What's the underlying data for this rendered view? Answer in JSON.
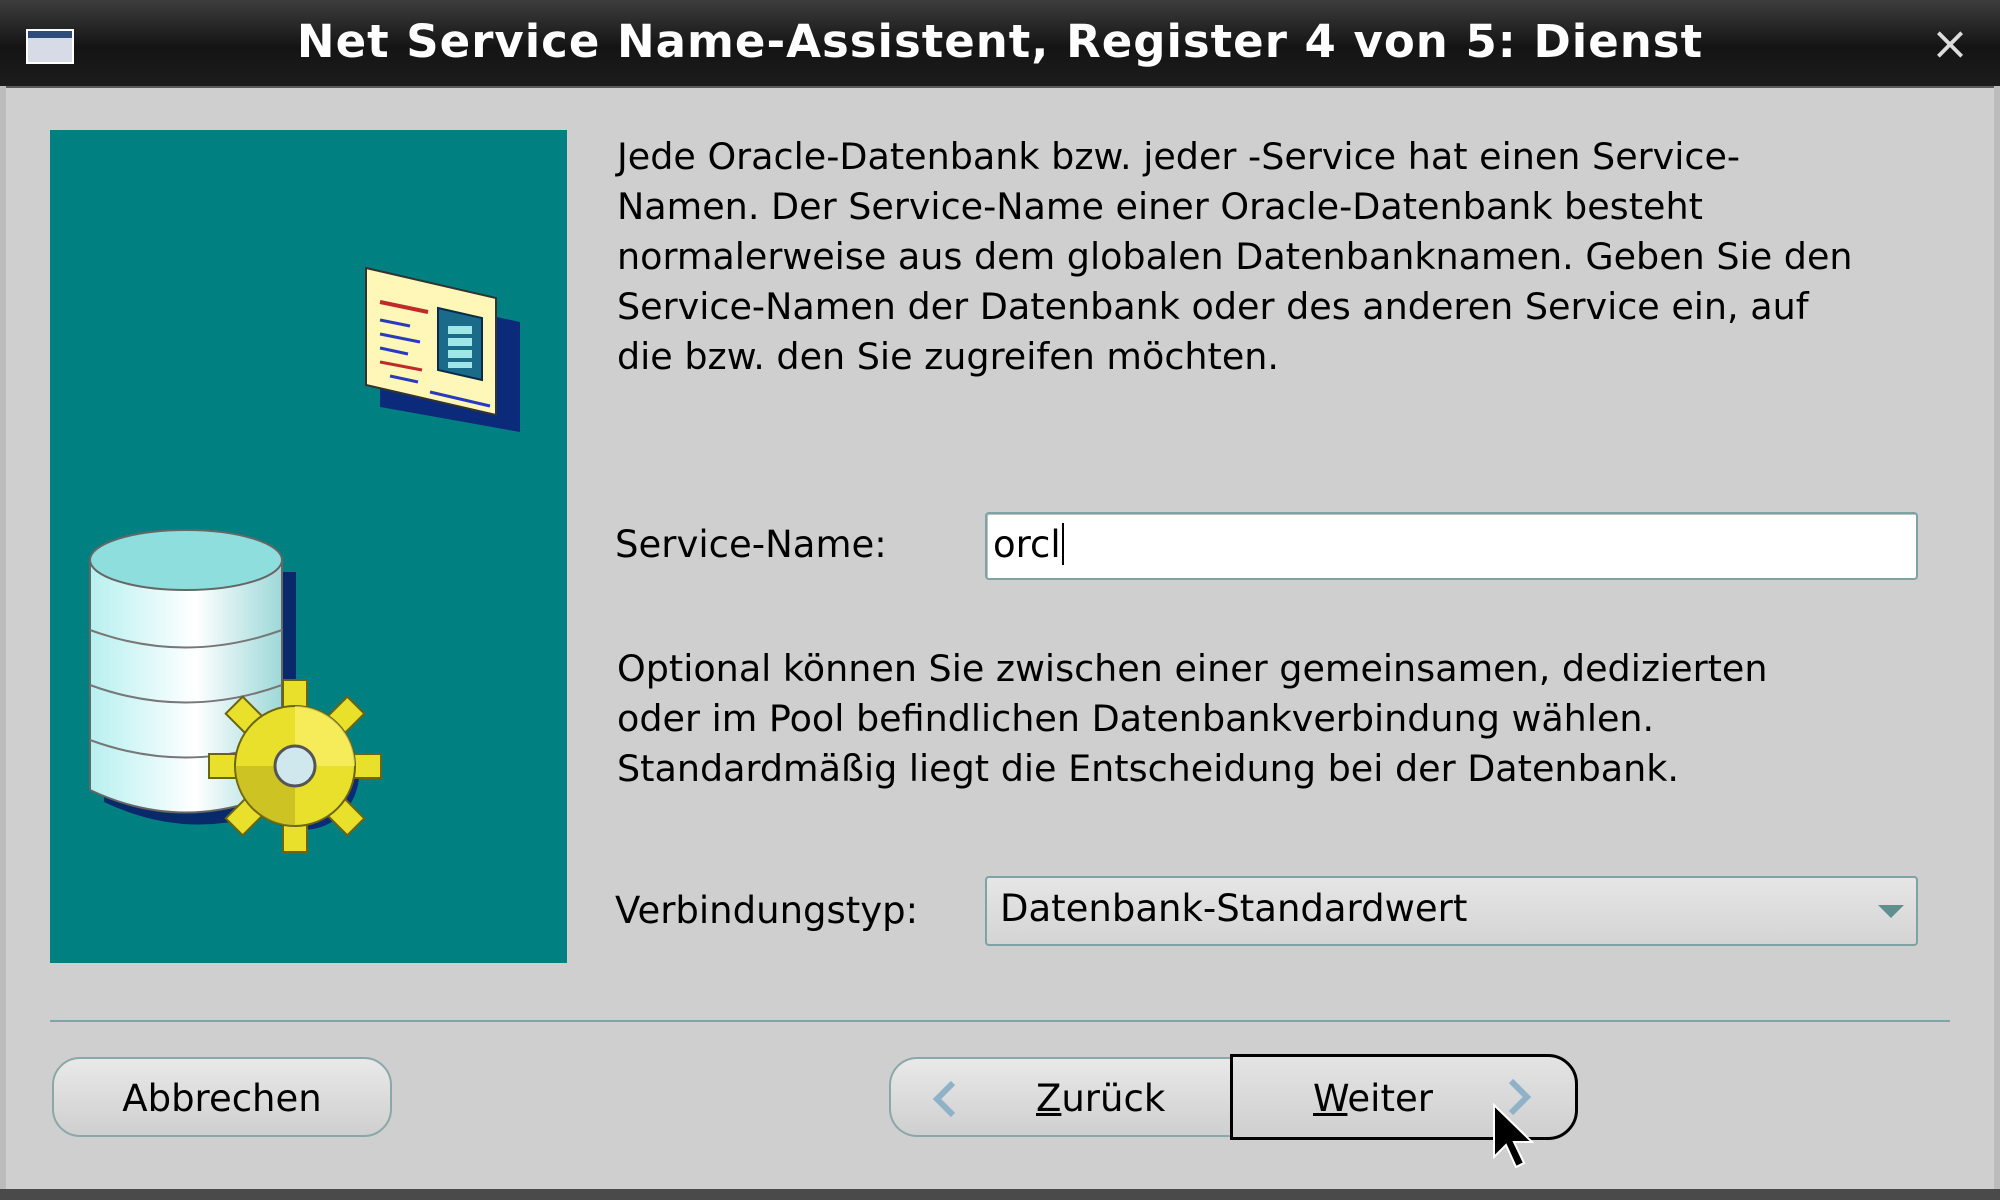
{
  "window": {
    "title": "Net Service Name-Assistent, Register 4 von 5: Dienst",
    "close_glyph": "×"
  },
  "intro_text": "Jede Oracle-Datenbank bzw. jeder -Service hat einen Service-\nNamen. Der Service-Name einer Oracle-Datenbank besteht\nnormalerweise aus dem globalen Datenbanknamen. Geben Sie den\nService-Namen der Datenbank oder des anderen Service ein, auf\ndie bzw. den Sie zugreifen möchten.",
  "service_name": {
    "label": "Service-Name:",
    "value": "orcl"
  },
  "connection_text": "Optional können Sie zwischen einer gemeinsamen, dedizierten\noder im Pool befindlichen Datenbankverbindung wählen.\nStandardmäßig liegt die Entscheidung bei der Datenbank.",
  "connection_type": {
    "label": "Verbindungstyp:",
    "selected": "Datenbank-Standardwert"
  },
  "buttons": {
    "cancel": "Abbrechen",
    "back_mnemonic": "Z",
    "back_rest": "urück",
    "next_mnemonic": "W",
    "next_rest": "eiter"
  },
  "icons": {
    "window_icon": "window-icon",
    "close": "close-icon",
    "back": "chevron-left-icon",
    "next": "chevron-right-icon",
    "database": "database-icon",
    "gear": "gear-icon",
    "document": "document-icon",
    "cursor": "mouse-pointer-icon"
  },
  "colors": {
    "illustration_bg": "#008080",
    "accent": "#7aa8a8",
    "gear": "#e8e02a"
  }
}
